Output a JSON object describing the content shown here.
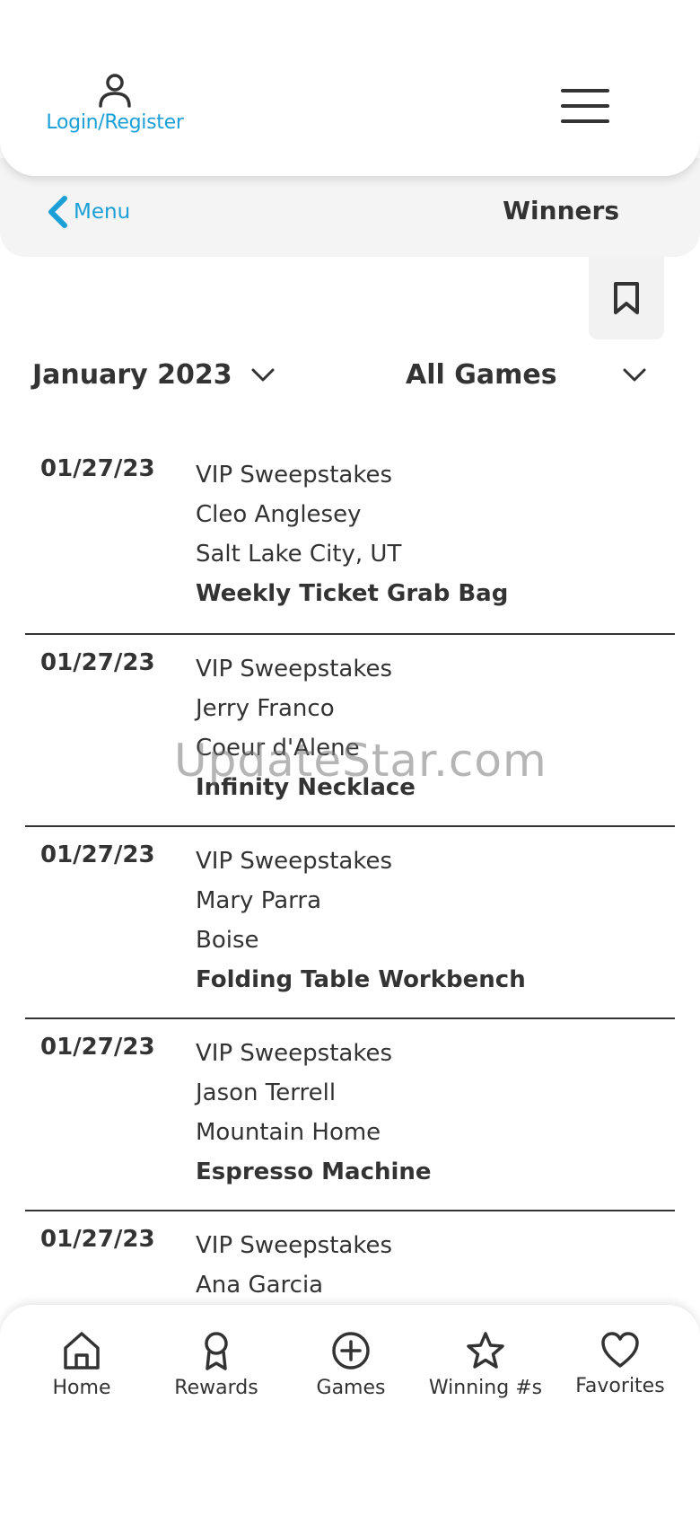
{
  "header": {
    "login_label": "Login/Register"
  },
  "subnav": {
    "back_label": "Menu",
    "title": "Winners"
  },
  "filters": {
    "month": "January 2023",
    "games": "All Games"
  },
  "winners": [
    {
      "date": "01/27/23",
      "game": "VIP Sweepstakes",
      "name": "Cleo Anglesey",
      "location": "Salt Lake City, UT",
      "prize": "Weekly Ticket Grab Bag"
    },
    {
      "date": "01/27/23",
      "game": "VIP Sweepstakes",
      "name": "Jerry Franco",
      "location": "Coeur d'Alene",
      "prize": "Infinity Necklace"
    },
    {
      "date": "01/27/23",
      "game": "VIP Sweepstakes",
      "name": "Mary Parra",
      "location": "Boise",
      "prize": "Folding Table Workbench"
    },
    {
      "date": "01/27/23",
      "game": "VIP Sweepstakes",
      "name": "Jason Terrell",
      "location": "Mountain Home",
      "prize": "Espresso Machine"
    },
    {
      "date": "01/27/23",
      "game": "VIP Sweepstakes",
      "name": "Ana Garcia",
      "location": "",
      "prize": ""
    }
  ],
  "watermark": "UpdateStar.com",
  "bottom_nav": {
    "items": [
      {
        "label": "Home",
        "icon": "home-icon"
      },
      {
        "label": "Rewards",
        "icon": "ribbon-icon"
      },
      {
        "label": "Games",
        "icon": "plus-circle-icon"
      },
      {
        "label": "Winning #s",
        "icon": "star-icon"
      },
      {
        "label": "Favorites",
        "icon": "heart-icon"
      }
    ]
  },
  "colors": {
    "accent": "#1aa0d6",
    "text": "#333333",
    "subnav_bg": "#f4f4f4"
  }
}
